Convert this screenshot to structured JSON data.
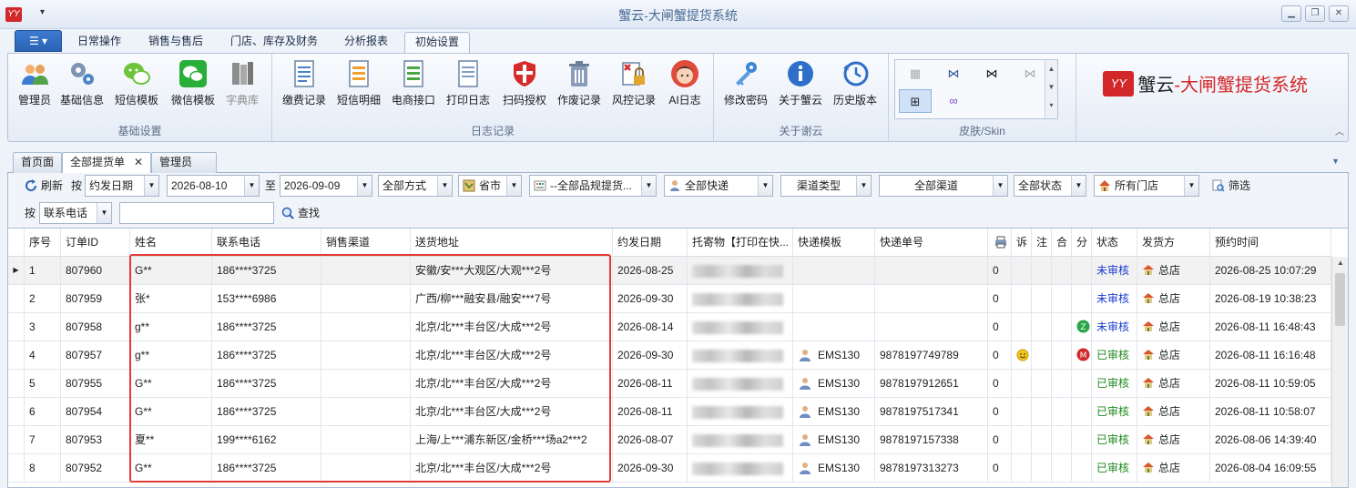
{
  "window": {
    "title": "蟹云-大闸蟹提货系统",
    "app_icon_text": "YY"
  },
  "ribbon_tabs": [
    {
      "label": "日常操作"
    },
    {
      "label": "销售与售后"
    },
    {
      "label": "门店、库存及财务"
    },
    {
      "label": "分析报表"
    },
    {
      "label": "初始设置",
      "active": true
    }
  ],
  "ribbon_groups": {
    "basic": {
      "label": "基础设置",
      "buttons": [
        "管理员",
        "基础信息",
        "短信模板",
        "微信模板",
        "字典库"
      ]
    },
    "logs": {
      "label": "日志记录",
      "buttons": [
        "缴费记录",
        "短信明细",
        "电商接口",
        "打印日志",
        "扫码授权",
        "作废记录",
        "风控记录",
        "AI日志"
      ]
    },
    "about": {
      "label": "关于谢云",
      "buttons": [
        "修改密码",
        "关于蟹云",
        "历史版本"
      ]
    },
    "skin": {
      "label": "皮肤/Skin"
    }
  },
  "brand": {
    "part1": "蟹云",
    "part2": "-大闸蟹提货系统"
  },
  "doc_tabs": [
    {
      "label": "首页面"
    },
    {
      "label": "全部提货单",
      "active": true,
      "closable": true
    },
    {
      "label": "管理员"
    }
  ],
  "filters": {
    "refresh_label": "刷新",
    "by_label": "按",
    "date_type": "约发日期",
    "date_from": "2026-08-10",
    "to_label": "至",
    "date_to": "2026-09-09",
    "method": "全部方式",
    "region": "省市",
    "product": "--全部品规提货...",
    "express": "全部快递",
    "channel_type": "渠道类型",
    "channel": "全部渠道",
    "status": "全部状态",
    "store": "所有门店",
    "filter_label": "筛选",
    "search_by_label": "按",
    "search_field": "联系电话",
    "search_value": "",
    "search_label": "查找"
  },
  "table": {
    "columns": [
      "序号",
      "订单ID",
      "姓名",
      "联系电话",
      "销售渠道",
      "送货地址",
      "约发日期",
      "托寄物【打印在快...",
      "快递模板",
      "快递单号",
      "",
      "诉",
      "注",
      "合",
      "分",
      "状态",
      "发货方",
      "预约时间"
    ],
    "rows": [
      {
        "seq": "1",
        "order_id": "807960",
        "name": "G**",
        "phone": "186****3725",
        "channel": "",
        "address": "安徽/安***大观区/大观***2号",
        "date": "2026-08-25",
        "template": "",
        "tracking": "",
        "print_count": "0",
        "complaint": "",
        "merge": "",
        "split": "",
        "status": "未审核",
        "status_kind": "pending",
        "shipper": "总店",
        "reserve_time": "2026-08-25 10:07:29",
        "selected": true
      },
      {
        "seq": "2",
        "order_id": "807959",
        "name": "张*",
        "phone": "153****6986",
        "channel": "",
        "address": "广西/柳***融安县/融安***7号",
        "date": "2026-09-30",
        "template": "",
        "tracking": "",
        "print_count": "0",
        "complaint": "",
        "merge": "",
        "split": "",
        "status": "未审核",
        "status_kind": "pending",
        "shipper": "总店",
        "reserve_time": "2026-08-19 10:38:23"
      },
      {
        "seq": "3",
        "order_id": "807958",
        "name": "g**",
        "phone": "186****3725",
        "channel": "",
        "address": "北京/北***丰台区/大成***2号",
        "date": "2026-08-14",
        "template": "",
        "tracking": "",
        "print_count": "0",
        "complaint": "",
        "merge": "",
        "split": "Z",
        "status": "未审核",
        "status_kind": "pending",
        "shipper": "总店",
        "reserve_time": "2026-08-11 16:48:43"
      },
      {
        "seq": "4",
        "order_id": "807957",
        "name": "g**",
        "phone": "186****3725",
        "channel": "",
        "address": "北京/北***丰台区/大成***2号",
        "date": "2026-09-30",
        "template": "EMS130",
        "tracking": "9878197749789",
        "print_count": "0",
        "complaint": "smile",
        "merge": "",
        "split": "M",
        "status": "已审核",
        "status_kind": "ok",
        "shipper": "总店",
        "reserve_time": "2026-08-11 16:16:48"
      },
      {
        "seq": "5",
        "order_id": "807955",
        "name": "G**",
        "phone": "186****3725",
        "channel": "",
        "address": "北京/北***丰台区/大成***2号",
        "date": "2026-08-11",
        "template": "EMS130",
        "tracking": "9878197912651",
        "print_count": "0",
        "complaint": "",
        "merge": "",
        "split": "",
        "status": "已审核",
        "status_kind": "ok",
        "shipper": "总店",
        "reserve_time": "2026-08-11 10:59:05"
      },
      {
        "seq": "6",
        "order_id": "807954",
        "name": "G**",
        "phone": "186****3725",
        "channel": "",
        "address": "北京/北***丰台区/大成***2号",
        "date": "2026-08-11",
        "template": "EMS130",
        "tracking": "9878197517341",
        "print_count": "0",
        "complaint": "",
        "merge": "",
        "split": "",
        "status": "已审核",
        "status_kind": "ok",
        "shipper": "总店",
        "reserve_time": "2026-08-11 10:58:07"
      },
      {
        "seq": "7",
        "order_id": "807953",
        "name": "夏**",
        "phone": "199****6162",
        "channel": "",
        "address": "上海/上***浦东新区/金桥***场a2***2",
        "date": "2026-08-07",
        "template": "EMS130",
        "tracking": "9878197157338",
        "print_count": "0",
        "complaint": "",
        "merge": "",
        "split": "",
        "status": "已审核",
        "status_kind": "ok",
        "shipper": "总店",
        "reserve_time": "2026-08-06 14:39:40"
      },
      {
        "seq": "8",
        "order_id": "807952",
        "name": "G**",
        "phone": "186****3725",
        "channel": "",
        "address": "北京/北***丰台区/大成***2号",
        "date": "2026-09-30",
        "template": "EMS130",
        "tracking": "9878197313273",
        "print_count": "0",
        "complaint": "",
        "merge": "",
        "split": "",
        "status": "已审核",
        "status_kind": "ok",
        "shipper": "总店",
        "reserve_time": "2026-08-04 16:09:55"
      }
    ]
  },
  "colors": {
    "accent": "#2b63b6",
    "brand_red": "#d3282a",
    "pending": "#1a3ccf",
    "approved": "#1f8a1f",
    "highlight_box": "#e53935"
  }
}
